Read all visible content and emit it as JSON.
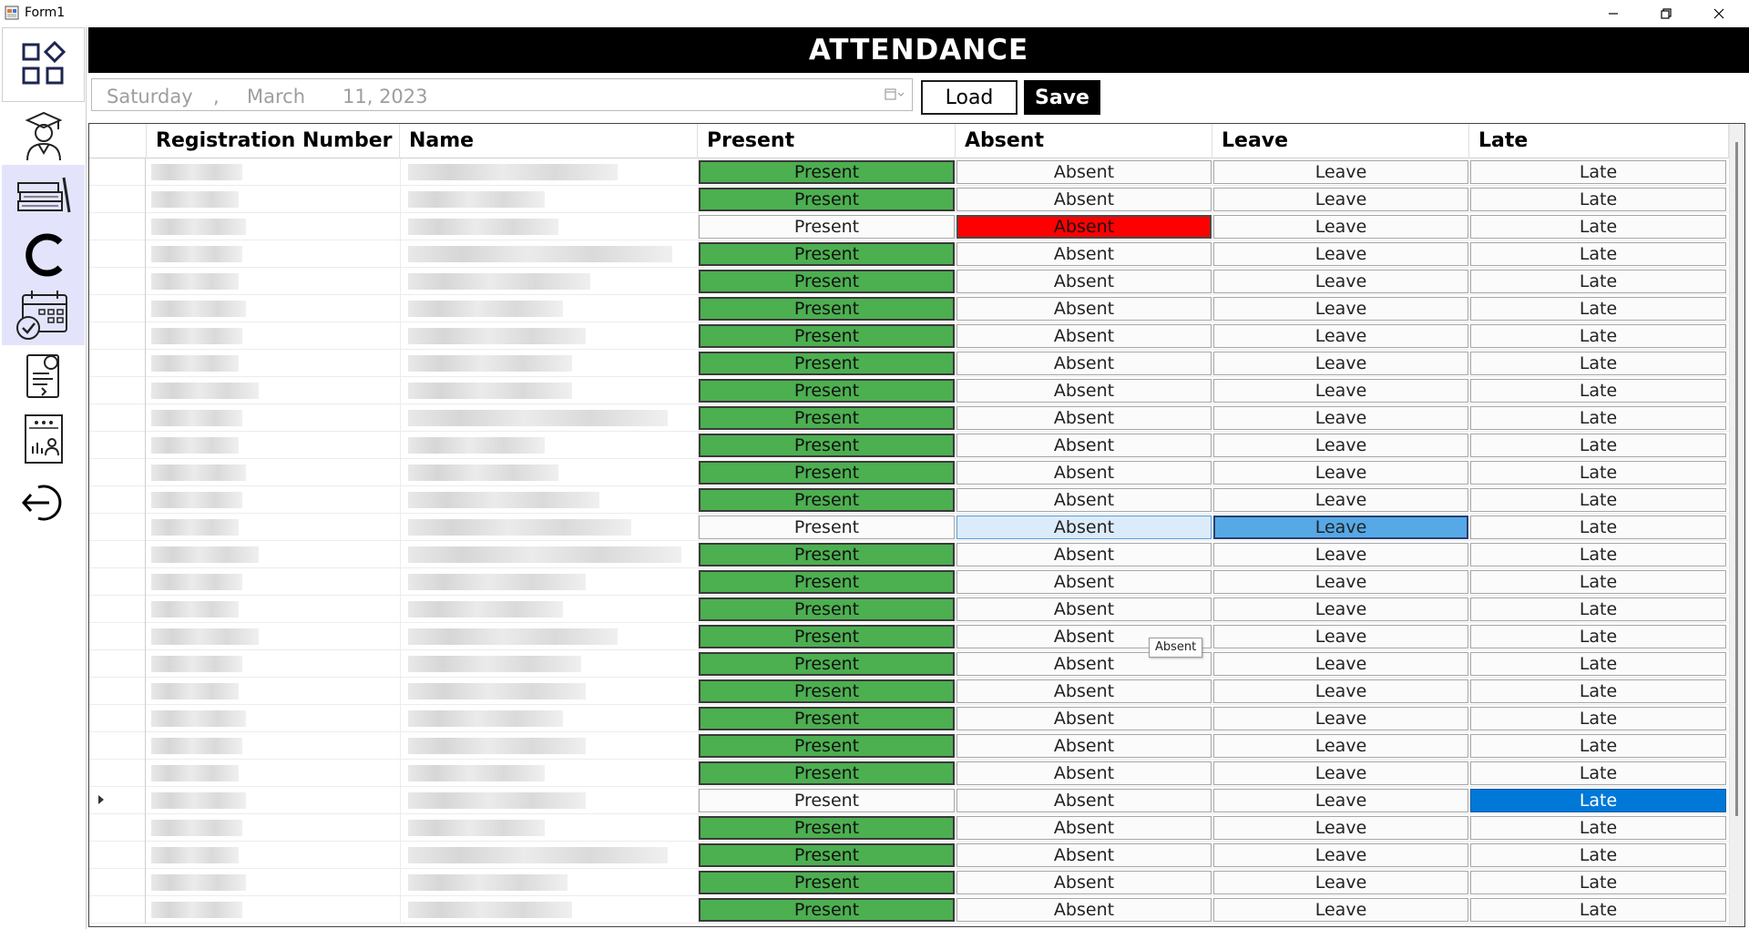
{
  "window": {
    "title": "Form1"
  },
  "header": {
    "title": "ATTENDANCE"
  },
  "date": {
    "weekday": "Saturday",
    "sep": ",",
    "month": "March",
    "day_year": "11, 2023"
  },
  "actions": {
    "load": "Load",
    "save": "Save"
  },
  "sidebar": {
    "items": [
      "dashboard-icon",
      "student-icon",
      "books-icon",
      "class-icon",
      "attendance-calendar-icon",
      "report-icon",
      "result-card-icon",
      "logout-icon"
    ]
  },
  "columns": [
    "Registration Number",
    "Name",
    "Present",
    "Absent",
    "Leave",
    "Late"
  ],
  "buttons": {
    "present": "Present",
    "absent": "Absent",
    "leave": "Leave",
    "late": "Late"
  },
  "tooltip": "Absent",
  "rows": [
    {
      "status": "present"
    },
    {
      "status": "present"
    },
    {
      "status": "absent"
    },
    {
      "status": "present"
    },
    {
      "status": "present"
    },
    {
      "status": "present"
    },
    {
      "status": "present"
    },
    {
      "status": "present"
    },
    {
      "status": "present"
    },
    {
      "status": "present"
    },
    {
      "status": "present"
    },
    {
      "status": "present"
    },
    {
      "status": "present"
    },
    {
      "status": "leave",
      "hover": "absent"
    },
    {
      "status": "present"
    },
    {
      "status": "present"
    },
    {
      "status": "present"
    },
    {
      "status": "present"
    },
    {
      "status": "present"
    },
    {
      "status": "present"
    },
    {
      "status": "present"
    },
    {
      "status": "present"
    },
    {
      "status": "present"
    },
    {
      "status": "late",
      "current": true
    },
    {
      "status": "present"
    },
    {
      "status": "present"
    },
    {
      "status": "present"
    },
    {
      "status": "present"
    }
  ],
  "colors": {
    "present": "#4caf50",
    "absent": "#ff0000",
    "leave": "#56a9e6",
    "late_selected": "#0078d7",
    "header_bg": "#000000",
    "sidebar_highlight": "#e3e4fb"
  }
}
